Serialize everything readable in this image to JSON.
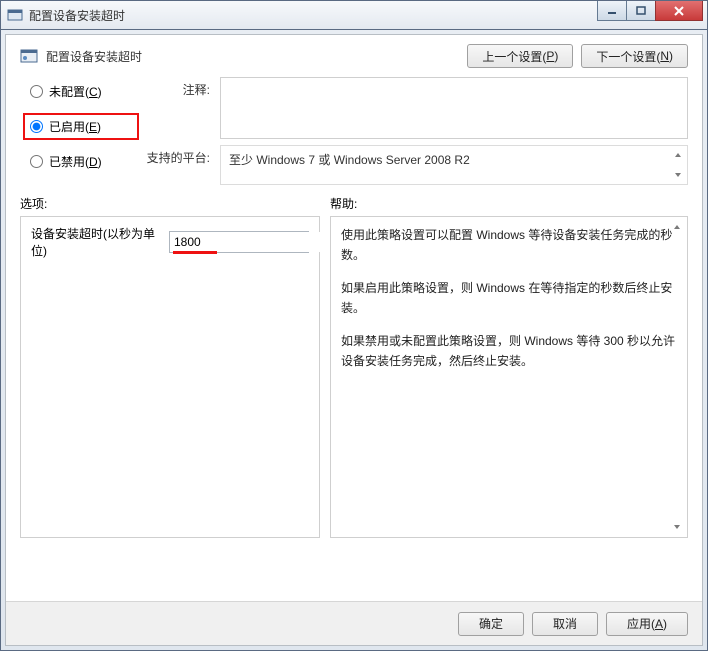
{
  "window": {
    "title": "配置设备安装超时"
  },
  "header": {
    "policy_title": "配置设备安装超时",
    "prev_label_pre": "上一个设置(",
    "prev_key": "P",
    "prev_label_post": ")",
    "next_label_pre": "下一个设置(",
    "next_key": "N",
    "next_label_post": ")"
  },
  "radios": {
    "unconfigured_pre": "未配置(",
    "unconfigured_key": "C",
    "unconfigured_post": ")",
    "enabled_pre": "已启用(",
    "enabled_key": "E",
    "enabled_post": ")",
    "disabled_pre": "已禁用(",
    "disabled_key": "D",
    "disabled_post": ")",
    "selected": "enabled"
  },
  "labels": {
    "comment": "注释:",
    "platform": "支持的平台:",
    "options": "选项:",
    "help": "帮助:"
  },
  "platform_text": "至少 Windows 7 或 Windows Server 2008 R2",
  "option": {
    "name": "设备安装超时(以秒为单位)",
    "value": "1800"
  },
  "help": {
    "p1": "使用此策略设置可以配置 Windows 等待设备安装任务完成的秒数。",
    "p2": "如果启用此策略设置，则 Windows 在等待指定的秒数后终止安装。",
    "p3": "如果禁用或未配置此策略设置，则 Windows 等待 300 秒以允许设备安装任务完成，然后终止安装。"
  },
  "footer": {
    "ok": "确定",
    "cancel": "取消",
    "apply_pre": "应用(",
    "apply_key": "A",
    "apply_post": ")"
  }
}
